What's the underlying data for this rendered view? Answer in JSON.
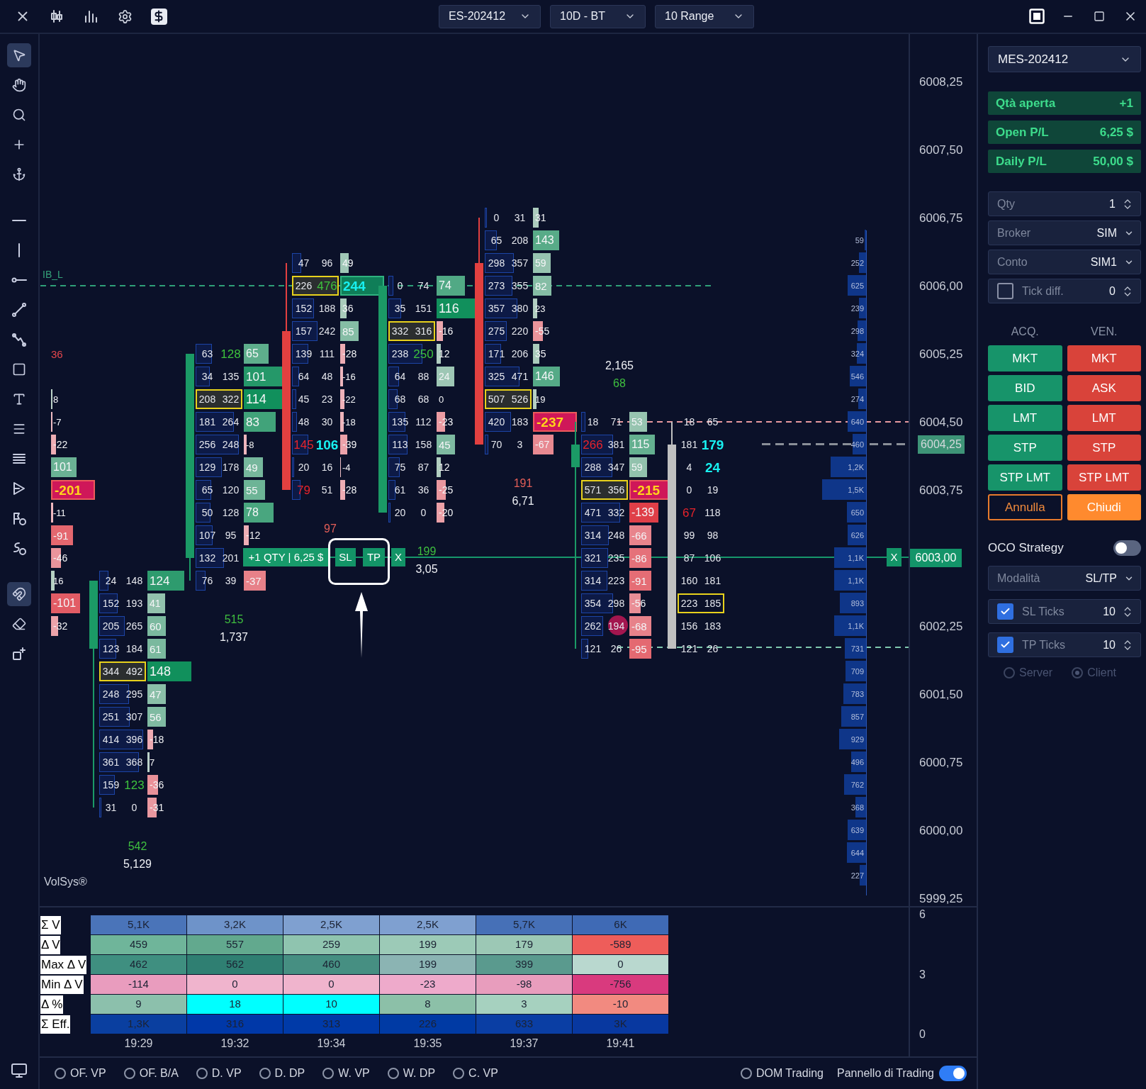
{
  "top_bar": {
    "selectors": [
      {
        "value": "ES-202412"
      },
      {
        "value": "10D - BT"
      },
      {
        "value": "10 Range"
      }
    ]
  },
  "left_toolbar": {
    "groups": [
      {
        "tools": [
          {
            "selected": true
          },
          {
            "selected": false
          },
          {
            "selected": false
          },
          {
            "selected": false
          },
          {
            "selected": false
          }
        ]
      },
      {
        "tools": [
          {
            "selected": false
          },
          {
            "selected": false
          },
          {
            "selected": false
          },
          {
            "selected": false
          },
          {
            "selected": false
          },
          {
            "selected": false
          },
          {
            "selected": false
          },
          {
            "selected": false
          },
          {
            "selected": false
          },
          {
            "selected": false
          },
          {
            "selected": false
          },
          {
            "selected": false
          }
        ]
      },
      {
        "tools": [
          {
            "selected": true
          },
          {
            "selected": false
          },
          {
            "selected": false
          }
        ]
      }
    ]
  },
  "chart": {
    "level_label": "IB_L",
    "brand": "VolSys®",
    "columns": [
      {
        "kind": "edge",
        "cells": [
          null,
          null,
          null,
          null,
          null,
          null,
          {
            "delta": {
              "value": "36",
              "kind": "bare"
            }
          },
          null,
          {
            "delta": "8"
          },
          {
            "delta": "-7"
          },
          {
            "delta": "-22"
          },
          {
            "delta": "101"
          },
          {
            "delta": {
              "value": "-201",
              "kind": "extreme"
            }
          },
          {
            "delta": "-11"
          },
          {
            "delta": "-91"
          },
          {
            "delta": "-46"
          },
          {
            "delta": "16"
          },
          {
            "delta": "-101"
          },
          {
            "delta": "-32"
          }
        ]
      },
      {
        "kind": "up",
        "cells": [
          null,
          null,
          null,
          null,
          null,
          null,
          null,
          null,
          null,
          null,
          null,
          null,
          null,
          null,
          null,
          null,
          {
            "bid": "24",
            "ask": "148",
            "delta": "124",
            "poc": false
          },
          {
            "bid": "152",
            "ask": "193",
            "delta": "41",
            "poc": false
          },
          {
            "bid": "205",
            "ask": "265",
            "delta": "60",
            "poc": false
          },
          {
            "bid": "123",
            "ask": "184",
            "delta": "61",
            "poc": false
          },
          {
            "bid": "344",
            "ask": "492",
            "delta": "148",
            "poc": true
          },
          {
            "bid": "248",
            "ask": "295",
            "delta": "47",
            "poc": false
          },
          {
            "bid": "251",
            "ask": "307",
            "delta": "56",
            "poc": false
          },
          {
            "bid": "414",
            "ask": "396",
            "delta": "-18",
            "poc": false
          },
          {
            "bid": "361",
            "ask": "368",
            "delta": "7",
            "poc": false
          },
          {
            "bid": "159",
            "ask": {
              "value": "123",
              "kind": "green"
            },
            "delta": "-36",
            "poc": false
          },
          {
            "bid": "31",
            "ask": "0",
            "delta": "-31",
            "poc": false
          }
        ],
        "totals": {
          "kind": "below",
          "delta": {
            "value": "542",
            "kind": "green"
          },
          "volume": "5,129"
        }
      },
      {
        "kind": "up",
        "cells": [
          null,
          null,
          null,
          null,
          null,
          null,
          {
            "bid": "63",
            "ask": {
              "value": "128",
              "kind": "green"
            },
            "delta": "65",
            "poc": false
          },
          {
            "bid": "34",
            "ask": "135",
            "delta": "101",
            "poc": false
          },
          {
            "bid": "208",
            "ask": "322",
            "delta": "114",
            "poc": true
          },
          {
            "bid": "181",
            "ask": "264",
            "delta": "83",
            "poc": false
          },
          {
            "bid": "256",
            "ask": "248",
            "delta": "-8",
            "poc": false
          },
          {
            "bid": "129",
            "ask": "178",
            "delta": "49",
            "poc": false
          },
          {
            "bid": "65",
            "ask": "120",
            "delta": "55",
            "poc": false
          },
          {
            "bid": "50",
            "ask": "128",
            "delta": "78",
            "poc": false
          },
          {
            "bid": "107",
            "ask": "95",
            "delta": "-12",
            "poc": false
          },
          {
            "bid": "132",
            "ask": "201",
            "poc": false
          },
          {
            "bid": "76",
            "ask": "39",
            "delta": "-37",
            "poc": false
          }
        ],
        "totals": {
          "kind": "below",
          "delta": {
            "value": "515",
            "kind": "green"
          },
          "volume": "1,737"
        }
      },
      {
        "kind": "down",
        "cells": [
          null,
          null,
          {
            "bid": "47",
            "ask": "96",
            "delta": "49",
            "poc": false
          },
          {
            "bid": "226",
            "ask": {
              "value": "476",
              "kind": "green"
            },
            "delta": {
              "value": "244",
              "kind": "accent"
            },
            "poc": true
          },
          {
            "bid": "152",
            "ask": "188",
            "delta": "36",
            "poc": false
          },
          {
            "bid": "157",
            "ask": "242",
            "delta": "85",
            "poc": false
          },
          {
            "bid": "139",
            "ask": "111",
            "delta": "-28",
            "poc": false
          },
          {
            "bid": "64",
            "ask": "48",
            "delta": "-16",
            "poc": false
          },
          {
            "bid": "45",
            "ask": "23",
            "delta": "-22",
            "poc": false
          },
          {
            "bid": "48",
            "ask": "30",
            "delta": "-18",
            "poc": false
          },
          {
            "bid": {
              "value": "145",
              "kind": "red"
            },
            "ask": {
              "value": "106",
              "kind": "cyan"
            },
            "delta": "-39",
            "poc": false
          },
          {
            "bid": "20",
            "ask": "16",
            "delta": "-4",
            "poc": false
          },
          {
            "bid": {
              "value": "79",
              "kind": "red"
            },
            "ask": "51",
            "delta": "-28",
            "poc": false
          }
        ],
        "totals": {
          "kind": "below",
          "delta": {
            "value": "97",
            "kind": "red"
          }
        }
      },
      {
        "kind": "up",
        "cells": [
          null,
          null,
          null,
          {
            "bid": "0",
            "ask": "74",
            "delta": "74",
            "poc": false
          },
          {
            "bid": "35",
            "ask": "151",
            "delta": "116",
            "poc": false
          },
          {
            "bid": "332",
            "ask": "316",
            "delta": "-16",
            "poc": true
          },
          {
            "bid": "238",
            "ask": {
              "value": "250",
              "kind": "green"
            },
            "delta": "12",
            "poc": false
          },
          {
            "bid": "64",
            "ask": "88",
            "delta": "24",
            "poc": false
          },
          {
            "bid": "68",
            "ask": "68",
            "delta": "0",
            "poc": false
          },
          {
            "bid": "135",
            "ask": "112",
            "delta": "-23",
            "poc": false
          },
          {
            "bid": "113",
            "ask": "158",
            "delta": "45",
            "poc": false
          },
          {
            "bid": "75",
            "ask": "87",
            "delta": "12",
            "poc": false
          },
          {
            "bid": "61",
            "ask": "36",
            "delta": "-25",
            "poc": false
          },
          {
            "bid": "20",
            "ask": "0",
            "delta": "-20",
            "poc": false
          }
        ],
        "totals": {
          "kind": "below",
          "delta": {
            "value": "199",
            "kind": "green"
          },
          "volume": "3,05"
        }
      },
      {
        "kind": "down",
        "cells": [
          {
            "bid": "0",
            "ask": "31",
            "delta": "31",
            "poc": false
          },
          {
            "bid": "65",
            "ask": "208",
            "delta": "143",
            "poc": false
          },
          {
            "bid": "298",
            "ask": "357",
            "delta": "59",
            "poc": false
          },
          {
            "bid": "273",
            "ask": "355",
            "delta": "82",
            "poc": false
          },
          {
            "bid": "357",
            "ask": "380",
            "delta": "23",
            "poc": false
          },
          {
            "bid": "275",
            "ask": "220",
            "delta": "-55",
            "poc": false
          },
          {
            "bid": "171",
            "ask": "206",
            "delta": "35",
            "poc": false
          },
          {
            "bid": "325",
            "ask": "471",
            "delta": "146",
            "poc": false
          },
          {
            "bid": "507",
            "ask": "526",
            "delta": "19",
            "poc": true
          },
          {
            "bid": "420",
            "ask": "183",
            "delta": {
              "value": "-237",
              "kind": "extreme"
            },
            "poc": false
          },
          {
            "bid": "70",
            "ask": "3",
            "delta": "-67",
            "poc": false
          }
        ],
        "totals": {
          "kind": "below",
          "delta": {
            "value": "191",
            "kind": "red"
          },
          "volume": "6,71"
        }
      },
      {
        "kind": "up",
        "cells": [
          null,
          null,
          null,
          null,
          null,
          null,
          null,
          null,
          null,
          {
            "bid": "18",
            "ask": "71",
            "delta": "53",
            "poc": false
          },
          {
            "bid": {
              "value": "266",
              "kind": "red"
            },
            "ask": "381",
            "delta": "115",
            "poc": false
          },
          {
            "bid": "288",
            "ask": "347",
            "delta": "59",
            "poc": false
          },
          {
            "bid": "571",
            "ask": "356",
            "delta": {
              "value": "-215",
              "kind": "extreme"
            },
            "poc": true
          },
          {
            "bid": "471",
            "ask": "332",
            "delta": "-139",
            "poc": false
          },
          {
            "bid": "314",
            "ask": "248",
            "delta": "-66",
            "poc": false
          },
          {
            "bid": "321",
            "ask": "235",
            "delta": "-86",
            "poc": false
          },
          {
            "bid": "314",
            "ask": "223",
            "delta": "-91",
            "poc": false
          },
          {
            "bid": "354",
            "ask": "298",
            "delta": "-56",
            "poc": false
          },
          {
            "bid": "262",
            "ask": "194",
            "delta": "-68",
            "poc": false
          },
          {
            "bid": "121",
            "ask": "26",
            "delta": "-95",
            "poc": false
          }
        ],
        "totals": {
          "kind": "above",
          "delta": {
            "value": "68",
            "kind": "green"
          },
          "volume": "2,165"
        }
      },
      {
        "kind": "live",
        "cells": [
          null,
          null,
          null,
          null,
          null,
          null,
          null,
          null,
          null,
          {
            "bid": "18",
            "ask": "65",
            "poc": false
          },
          {
            "bid": "181",
            "ask": {
              "value": "179",
              "kind": "cyan"
            },
            "poc": false
          },
          {
            "bid": "4",
            "ask": {
              "value": "24",
              "kind": "cyan"
            },
            "poc": false
          },
          {
            "bid": "0",
            "ask": "19",
            "poc": false
          },
          {
            "bid": {
              "value": "67",
              "kind": "red"
            },
            "ask": "118",
            "poc": false
          },
          {
            "bid": "99",
            "ask": "98",
            "poc": false
          },
          {
            "bid": "87",
            "ask": "106",
            "poc": false
          },
          {
            "bid": "160",
            "ask": "181",
            "poc": false
          },
          {
            "bid": "223",
            "ask": "185",
            "poc": true
          },
          {
            "bid": "156",
            "ask": "183",
            "poc": false
          },
          {
            "bid": "121",
            "ask": "26",
            "poc": false
          }
        ]
      }
    ],
    "profile": [
      "59",
      "252",
      "625",
      "239",
      "298",
      "324",
      "546",
      "274",
      "640",
      "460",
      "1,2K",
      "1,5K",
      "650",
      "626",
      "1,1K",
      "1,1K",
      "893",
      "1,1K",
      "731",
      "709",
      "783",
      "857",
      "929",
      "496",
      "762",
      "368",
      "639",
      "644",
      "227"
    ],
    "position": {
      "label": "+1 QTY | 6,25 $",
      "stop": "SL",
      "target": "TP",
      "close": "X",
      "line_close": "X"
    },
    "price_axis": [
      {
        "label": "6008,25",
        "kind": "tick"
      },
      {
        "label": "6007,50",
        "kind": "tick"
      },
      {
        "label": "6006,75",
        "kind": "tick"
      },
      {
        "label": "6006,00",
        "kind": "tick"
      },
      {
        "label": "6005,25",
        "kind": "tick"
      },
      {
        "label": "6004,50",
        "kind": "tick"
      },
      {
        "label": "6003,75",
        "kind": "tick"
      },
      {
        "label": "6003,00",
        "kind": "position"
      },
      {
        "label": "6002,25",
        "kind": "tick"
      },
      {
        "label": "6001,50",
        "kind": "tick"
      },
      {
        "label": "6000,75",
        "kind": "tick"
      },
      {
        "label": "6000,00",
        "kind": "tick"
      },
      {
        "label": "5999,25",
        "kind": "tick"
      }
    ],
    "last_price": "6004,25"
  },
  "lower_panel": {
    "rows": [
      {
        "label": "Σ V",
        "cells": [
          {
            "value": "5,1K",
            "color": "#4a74b9"
          },
          {
            "value": "3,2K",
            "color": "#6e93c9"
          },
          {
            "value": "2,5K",
            "color": "#7fa0d0"
          },
          {
            "value": "2,5K",
            "color": "#7fa0d0"
          },
          {
            "value": "5,7K",
            "color": "#4670b7"
          },
          {
            "value": "6K",
            "color": "#3f6ab5"
          }
        ]
      },
      {
        "label": "Δ V",
        "cells": [
          {
            "value": "459",
            "color": "#6fb59a"
          },
          {
            "value": "557",
            "color": "#62a98e"
          },
          {
            "value": "259",
            "color": "#8fc4af"
          },
          {
            "value": "199",
            "color": "#9ccab7"
          },
          {
            "value": "179",
            "color": "#9cc8b5"
          },
          {
            "value": "-589",
            "color": "#ee5d5a"
          }
        ]
      },
      {
        "label": "Max Δ V",
        "cells": [
          {
            "value": "462",
            "color": "#3f8f80"
          },
          {
            "value": "562",
            "color": "#2f7f72"
          },
          {
            "value": "460",
            "color": "#468f82"
          },
          {
            "value": "199",
            "color": "#8bb4b3"
          },
          {
            "value": "399",
            "color": "#5a9a8e"
          },
          {
            "value": "0",
            "color": "#b9d8cf"
          }
        ]
      },
      {
        "label": "Min Δ V",
        "cells": [
          {
            "value": "-114",
            "color": "#e99cbe"
          },
          {
            "value": "0",
            "color": "#f0b4cd"
          },
          {
            "value": "0",
            "color": "#f0b4cd"
          },
          {
            "value": "-23",
            "color": "#eeaacb"
          },
          {
            "value": "-98",
            "color": "#e89dbd"
          },
          {
            "value": "-756",
            "color": "#d93a7e"
          }
        ]
      },
      {
        "label": "Δ %",
        "cells": [
          {
            "value": "9",
            "color": "#8cc0ac"
          },
          {
            "value": "18",
            "color": "#00ffff"
          },
          {
            "value": "10",
            "color": "#00ffff"
          },
          {
            "value": "8",
            "color": "#8cc0a8"
          },
          {
            "value": "3",
            "color": "#a6d1bf"
          },
          {
            "value": "-10",
            "color": "#f28a80"
          }
        ]
      },
      {
        "label": "Σ Eff.",
        "cells": [
          {
            "value": "1,3K",
            "color": "#0a3fa0"
          },
          {
            "value": "316",
            "color": "#0038a8"
          },
          {
            "value": "313",
            "color": "#003aa8"
          },
          {
            "value": "226",
            "color": "#003aa4"
          },
          {
            "value": "633",
            "color": "#0a3ea4"
          },
          {
            "value": "3K",
            "color": "#0838a0"
          }
        ]
      }
    ],
    "times": [
      "19:29",
      "19:32",
      "19:34",
      "19:35",
      "19:37",
      "19:41"
    ],
    "scale": [
      "6",
      "3",
      "0"
    ]
  },
  "bottom_bar": {
    "views": [
      {
        "label": "OF. VP",
        "selected": false
      },
      {
        "label": "OF. B/A",
        "selected": false
      },
      {
        "label": "D. VP",
        "selected": false
      },
      {
        "label": "D. DP",
        "selected": false
      },
      {
        "label": "W. VP",
        "selected": false
      },
      {
        "label": "W. DP",
        "selected": false
      },
      {
        "label": "C. VP",
        "selected": false
      }
    ],
    "dom": {
      "label": "DOM Trading",
      "selected": false
    },
    "panel": {
      "label": "Pannello di Trading",
      "on": true
    }
  },
  "trading_panel": {
    "symbol": "MES-202412",
    "stats": [
      {
        "label": "Qtà aperta",
        "value": "+1"
      },
      {
        "label": "Open P/L",
        "value": "6,25 $"
      },
      {
        "label": "Daily P/L",
        "value": "50,00 $"
      }
    ],
    "fields": [
      {
        "kind": "spinner",
        "label": "Qty",
        "value": "1"
      },
      {
        "kind": "select",
        "label": "Broker",
        "value": "SIM"
      },
      {
        "kind": "select",
        "label": "Conto",
        "value": "SIM1"
      },
      {
        "kind": "check_spinner",
        "label": "Tick diff.",
        "value": "0",
        "checked": false
      }
    ],
    "buy_header": "ACQ.",
    "sell_header": "VEN.",
    "buy_buttons": [
      "MKT",
      "BID",
      "LMT",
      "STP",
      "STP LMT"
    ],
    "sell_buttons": [
      "MKT",
      "ASK",
      "LMT",
      "STP",
      "STP LMT"
    ],
    "cancel": "Annulla",
    "close": "Chiudi",
    "oco": {
      "label": "OCO Strategy",
      "on": false
    },
    "oco_fields": [
      {
        "kind": "select",
        "label": "Modalità",
        "value": "SL/TP"
      },
      {
        "kind": "check_spinner",
        "label": "SL Ticks",
        "value": "10",
        "checked": true
      },
      {
        "kind": "check_spinner",
        "label": "TP Ticks",
        "value": "10",
        "checked": true
      }
    ],
    "execution": {
      "disabled": true,
      "options": [
        {
          "label": "Server",
          "selected": false
        },
        {
          "label": "Client",
          "selected": true
        }
      ]
    }
  }
}
